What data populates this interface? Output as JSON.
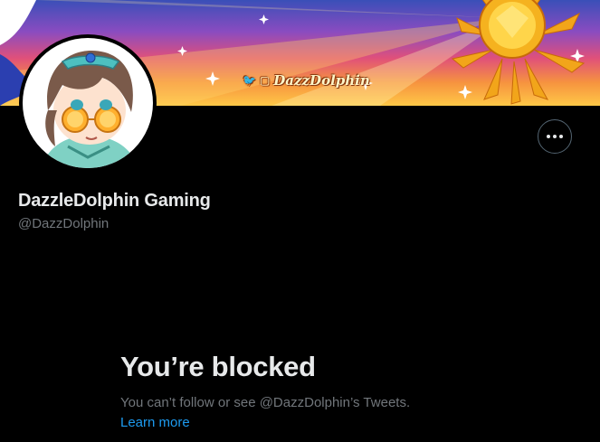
{
  "banner": {
    "tag_text": "DazzDolphin",
    "twitter_icon": "twitter-bird-icon",
    "twitch_icon": "twitch-icon"
  },
  "profile": {
    "display_name": "DazzleDolphin Gaming",
    "handle": "@DazzDolphin",
    "more_icon": "more-horizontal-icon"
  },
  "blocked": {
    "title": "You’re blocked",
    "description": "You can’t follow or see @DazzDolphin’s Tweets.",
    "learn_more": "Learn more"
  },
  "colors": {
    "background": "#000000",
    "primary_text": "#e7e9ea",
    "secondary_text": "#71767b",
    "link": "#1d9bf0",
    "border": "#536471"
  }
}
